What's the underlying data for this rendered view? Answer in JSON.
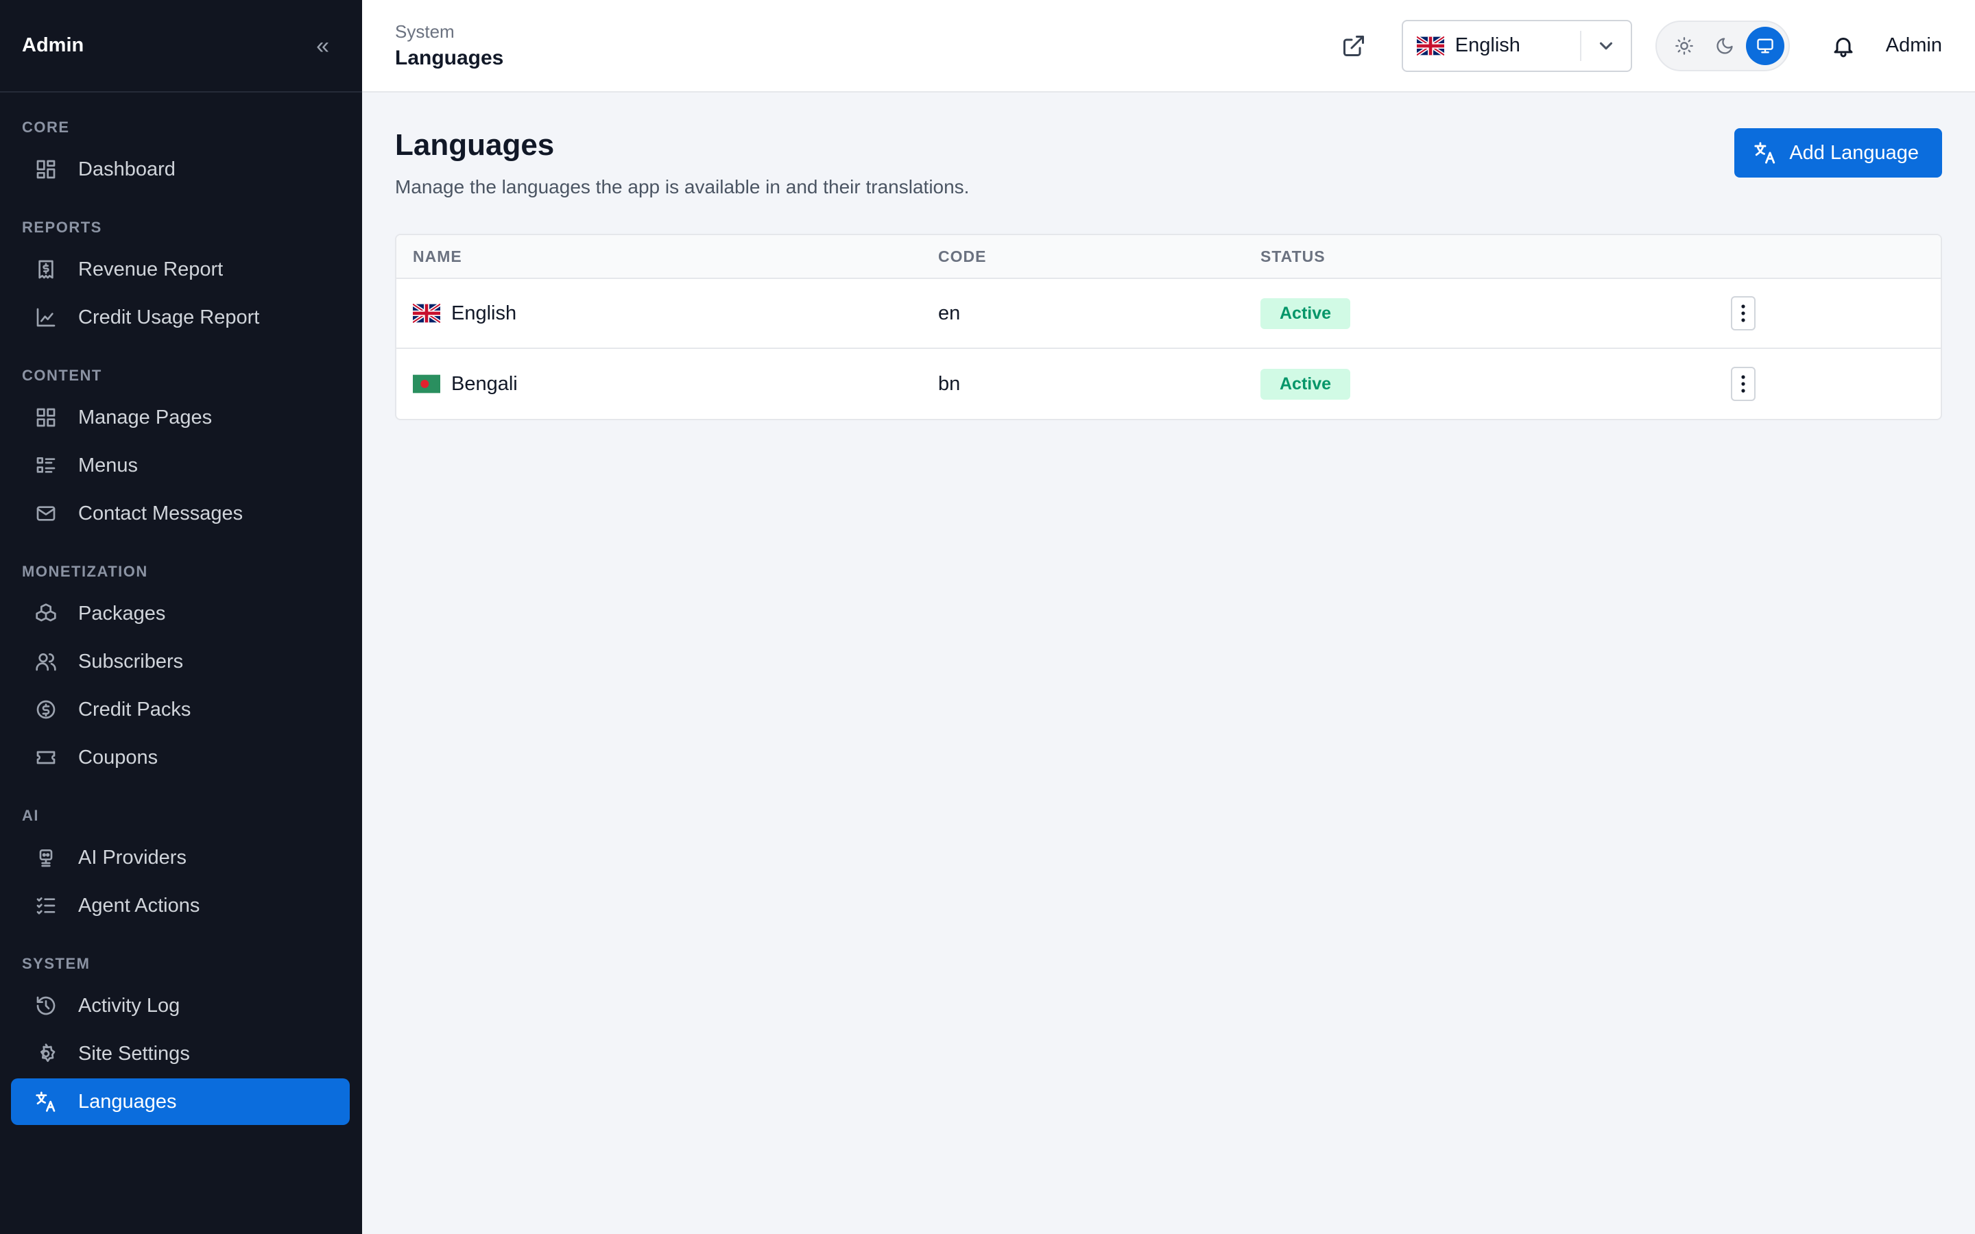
{
  "sidebar": {
    "title": "Admin",
    "sections": [
      {
        "label": "CORE",
        "items": [
          {
            "label": "Dashboard",
            "icon": "dashboard-icon"
          }
        ]
      },
      {
        "label": "REPORTS",
        "items": [
          {
            "label": "Revenue Report",
            "icon": "receipt-dollar-icon"
          },
          {
            "label": "Credit Usage Report",
            "icon": "chart-icon"
          }
        ]
      },
      {
        "label": "CONTENT",
        "items": [
          {
            "label": "Manage Pages",
            "icon": "grid-icon"
          },
          {
            "label": "Menus",
            "icon": "menu-list-icon"
          },
          {
            "label": "Contact Messages",
            "icon": "mail-icon"
          }
        ]
      },
      {
        "label": "MONETIZATION",
        "items": [
          {
            "label": "Packages",
            "icon": "boxes-icon"
          },
          {
            "label": "Subscribers",
            "icon": "users-icon"
          },
          {
            "label": "Credit Packs",
            "icon": "dollar-circle-icon"
          },
          {
            "label": "Coupons",
            "icon": "ticket-icon"
          }
        ]
      },
      {
        "label": "AI",
        "items": [
          {
            "label": "AI Providers",
            "icon": "robot-icon"
          },
          {
            "label": "Agent Actions",
            "icon": "checklist-icon"
          }
        ]
      },
      {
        "label": "SYSTEM",
        "items": [
          {
            "label": "Activity Log",
            "icon": "history-icon"
          },
          {
            "label": "Site Settings",
            "icon": "gear-icon"
          },
          {
            "label": "Languages",
            "icon": "translate-icon",
            "active": true
          }
        ]
      }
    ]
  },
  "topbar": {
    "breadcrumb_parent": "System",
    "breadcrumb_current": "Languages",
    "language_select_value": "English",
    "user_name": "Admin",
    "theme_active": "system"
  },
  "page": {
    "title": "Languages",
    "subtitle": "Manage the languages the app is available in and their translations.",
    "add_button_label": "Add Language"
  },
  "table": {
    "headers": {
      "name": "NAME",
      "code": "CODE",
      "status": "STATUS"
    },
    "rows": [
      {
        "name": "English",
        "code": "en",
        "status": "Active",
        "flag": "uk-flag-icon"
      },
      {
        "name": "Bengali",
        "code": "bn",
        "status": "Active",
        "flag": "bangladesh-flag-icon"
      }
    ]
  },
  "colors": {
    "accent": "#0b6ddd",
    "sidebar_bg": "#111520",
    "badge_bg": "#d1fae5",
    "badge_text": "#059669"
  }
}
